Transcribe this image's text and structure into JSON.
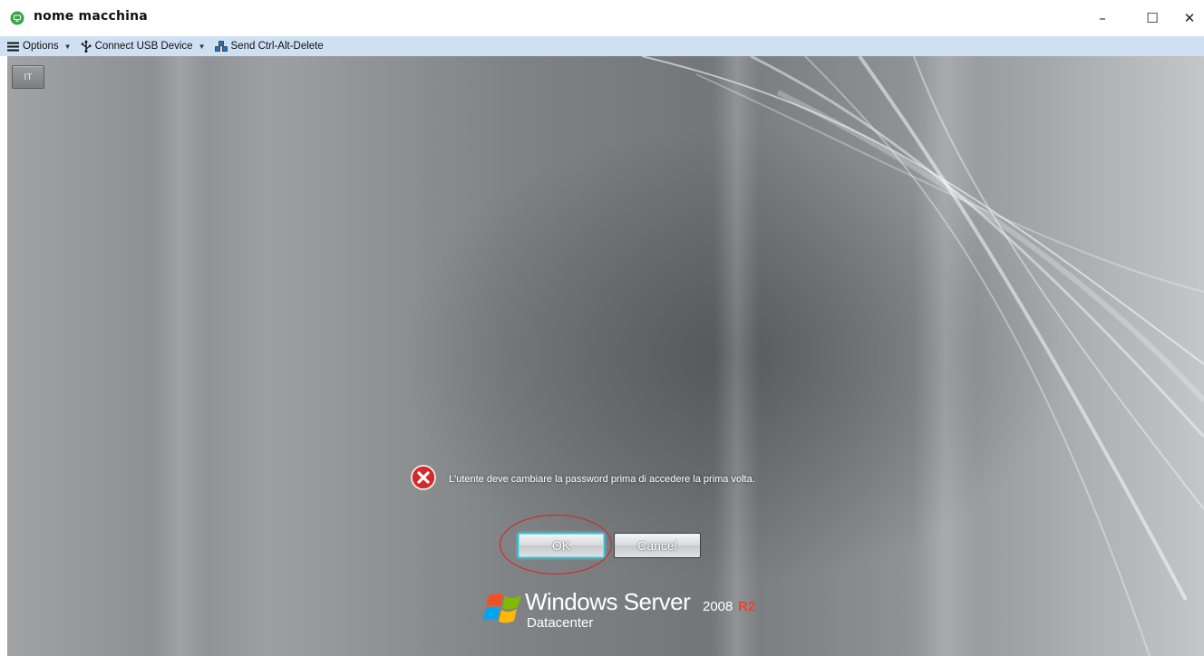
{
  "window": {
    "title": "nome macchina",
    "controls": {
      "minimize": "–",
      "maximize": "☐",
      "close": "✕"
    }
  },
  "toolbar": {
    "options_label": "Options",
    "usb_label": "Connect USB Device",
    "ctrl_alt_del_label": "Send Ctrl-Alt-Delete"
  },
  "desktop": {
    "language_button": "IT",
    "error_message": "L'utente deve cambiare la password prima di accedere la prima volta.",
    "ok_label": "OK",
    "cancel_label": "Cancel",
    "brand": {
      "name": "Windows Server",
      "version": "2008",
      "release": "R2",
      "edition": "Datacenter"
    }
  },
  "colors": {
    "toolbar_bg": "#cfe0f3",
    "error_red": "#d42a2a",
    "highlight_red": "#d62020",
    "focus_cyan": "#26c3dc",
    "r2_accent": "#e8452c"
  },
  "icons": {
    "app": "monitor-globe-icon",
    "options": "hamburger-menu-icon",
    "usb": "usb-icon",
    "ctrl_alt_del": "keyboard-icon",
    "error": "error-x-icon"
  }
}
